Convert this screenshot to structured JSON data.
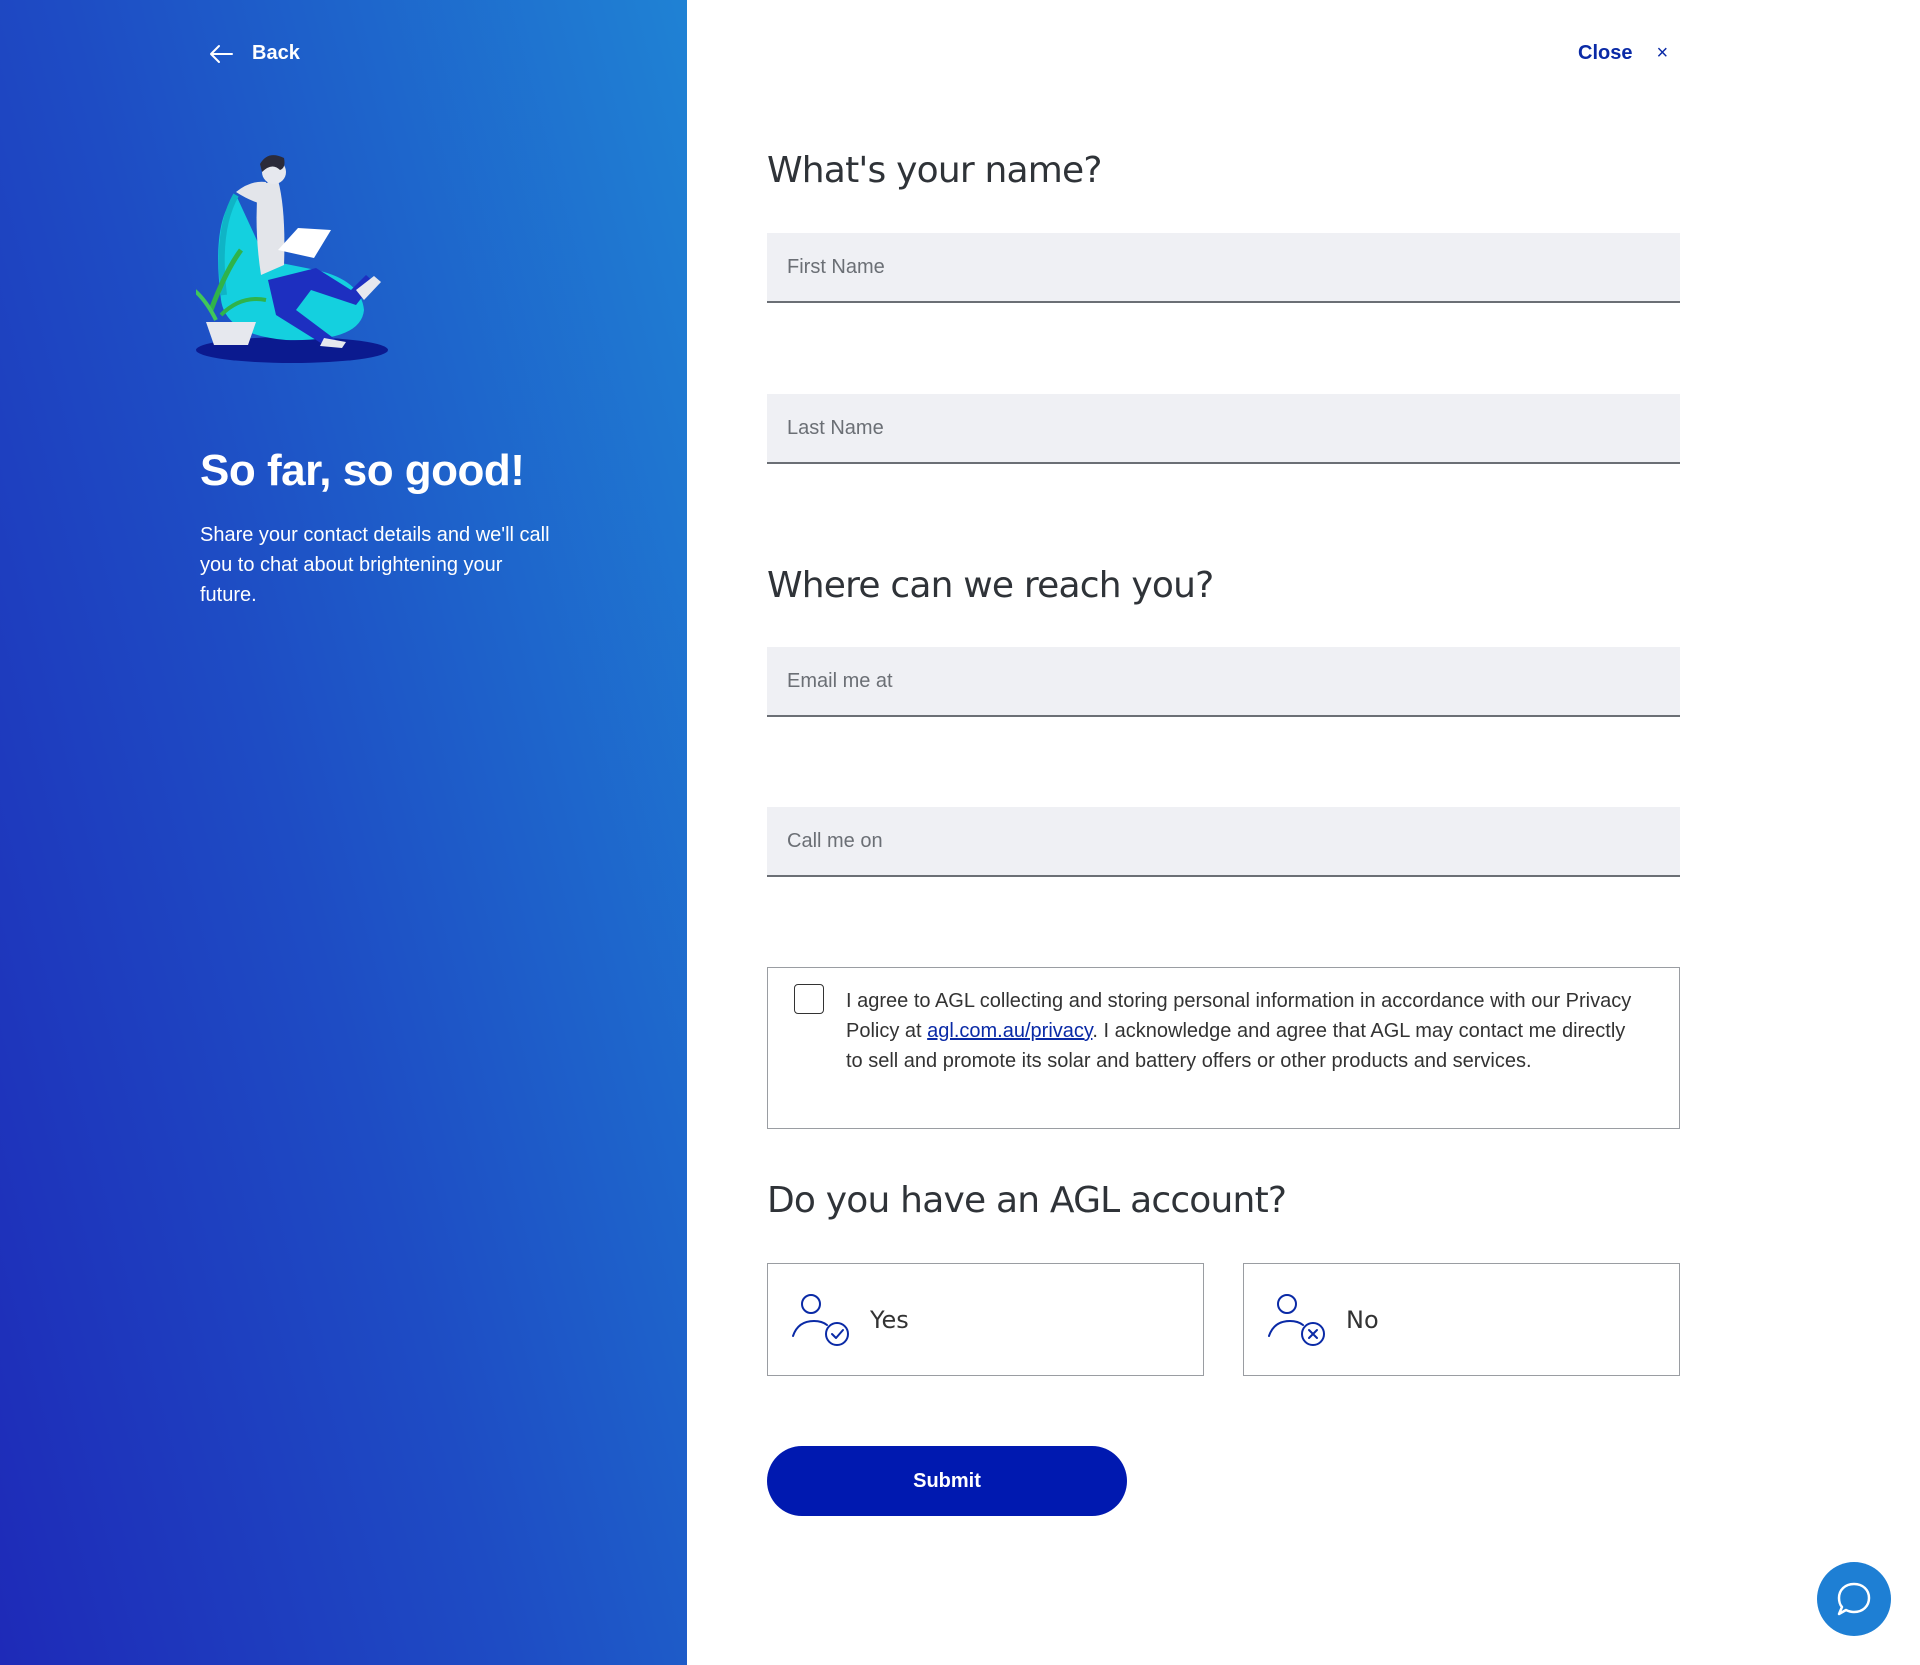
{
  "left_panel": {
    "back_label": "Back",
    "title": "So far, so good!",
    "description": "Share your contact details and we'll call you to chat about brightening your future."
  },
  "header": {
    "close_label": "Close",
    "close_glyph": "×"
  },
  "name_section": {
    "title": "What's your name?",
    "first_name_placeholder": "First Name",
    "last_name_placeholder": "Last Name"
  },
  "contact_section": {
    "title": "Where can we reach you?",
    "email_placeholder": "Email me at",
    "phone_placeholder": "Call me on"
  },
  "consent": {
    "checked": false,
    "text_before": "I agree to AGL collecting and storing personal information in accordance with our Privacy Policy at ",
    "link_text": "agl.com.au/privacy",
    "text_after": ". I acknowledge and agree that AGL may contact me directly to sell and promote its solar and battery offers or other products and services."
  },
  "account_section": {
    "title": "Do you have an AGL account?",
    "yes_label": "Yes",
    "no_label": "No",
    "yes_icon": "user-check-icon",
    "no_icon": "user-x-icon"
  },
  "submit_label": "Submit",
  "colors": {
    "brand_blue": "#0019b0",
    "link_blue": "#0a2aa6",
    "gradient_start": "#1e2ab8",
    "gradient_end": "#1f82d4",
    "chat_blue": "#1e7fd4",
    "field_bg": "#eff0f4"
  }
}
